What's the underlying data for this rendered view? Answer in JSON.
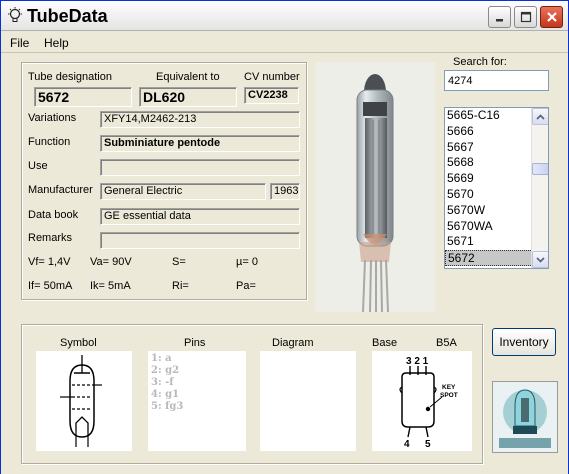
{
  "window": {
    "title": "TubeData"
  },
  "menu": {
    "file": "File",
    "help": "Help"
  },
  "info": {
    "tube_designation_label": "Tube designation",
    "tube_designation": "5672",
    "equivalent_label": "Equivalent to",
    "equivalent": "DL620",
    "cv_label": "CV number",
    "cv": "CV2238",
    "variations_label": "Variations",
    "variations": "XFY14,M2462-213",
    "function_label": "Function",
    "function": "Subminiature pentode",
    "use_label": "Use",
    "use": "",
    "manufacturer_label": "Manufacturer",
    "manufacturer": "General Electric",
    "year": "1963",
    "databook_label": "Data book",
    "databook": "GE essential data",
    "remarks_label": "Remarks",
    "remarks": ""
  },
  "params": {
    "vf": "Vf= 1,4V",
    "va": "Va= 90V",
    "s": "S=",
    "mu": "µ=   0",
    "if": "If= 50mA",
    "ik": "Ik=   5mA",
    "ri": "Ri=",
    "pa": "Pa="
  },
  "search": {
    "label": "Search for:",
    "value": "4274",
    "items": [
      "5665-C16",
      "5666",
      "5667",
      "5668",
      "5669",
      "5670",
      "5670W",
      "5670WA",
      "5671",
      "5672"
    ],
    "selected": "5672"
  },
  "bottom": {
    "symbol_label": "Symbol",
    "pins_label": "Pins",
    "diagram_label": "Diagram",
    "base_label": "Base",
    "base_type": "B5A",
    "pins": [
      "1: a",
      "2: g2",
      "3: -f",
      "4: g1",
      "5: fg3"
    ],
    "base_pin_top": "3 2 1",
    "base_pin_bottom_left": "4",
    "base_pin_bottom_right": "5",
    "key_label": "KEY",
    "spot_label": "SPOT"
  },
  "buttons": {
    "inventory": "Inventory"
  },
  "colors": {
    "title_bar_bg": "#f3f3f3",
    "close_button": "#c2351b",
    "window_bg": "#ece9d8",
    "list_selected": "#c7c7c7"
  }
}
